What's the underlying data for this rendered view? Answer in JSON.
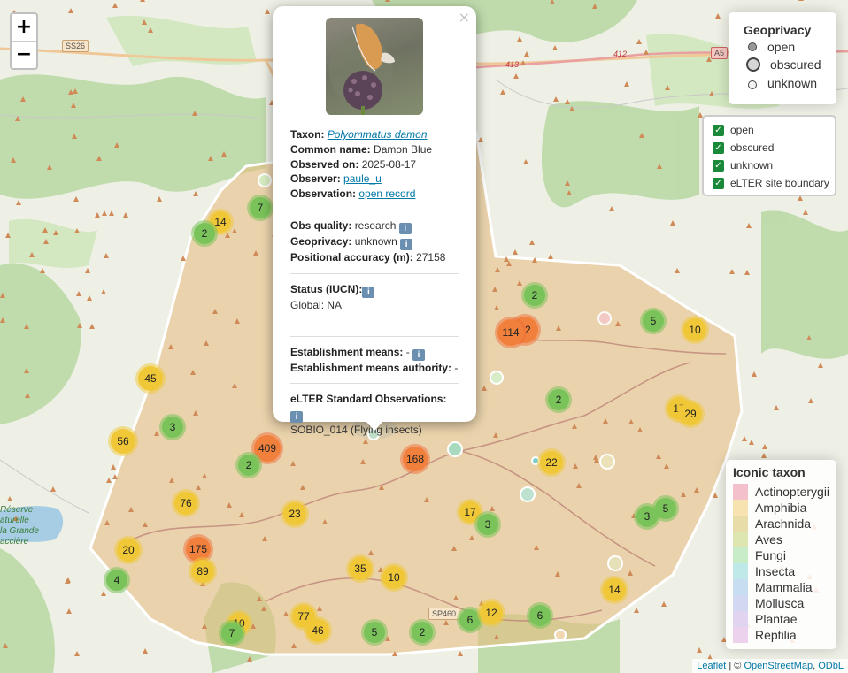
{
  "map": {
    "zoom_in": "+",
    "zoom_out": "−",
    "road_labels": [
      "SS26",
      "413",
      "412",
      "A5",
      "SP460"
    ],
    "place_label": [
      "Réserve",
      "aturelle",
      "la Grande",
      "ассière"
    ],
    "attribution": {
      "leaflet": "Leaflet",
      "sep": " | © ",
      "osm": "OpenStreetMap",
      "comma": ", ",
      "odbl": "ODbL"
    },
    "clusters": [
      {
        "label": "14",
        "color": "yellow"
      },
      {
        "label": "7",
        "color": "green"
      },
      {
        "label": "2",
        "color": "green"
      },
      {
        "label": "45",
        "color": "yellow"
      },
      {
        "label": "3",
        "color": "green"
      },
      {
        "label": "56",
        "color": "yellow"
      },
      {
        "label": "409",
        "color": "orange"
      },
      {
        "label": "2",
        "color": "green"
      },
      {
        "label": "76",
        "color": "yellow"
      },
      {
        "label": "23",
        "color": "yellow"
      },
      {
        "label": "20",
        "color": "yellow"
      },
      {
        "label": "175",
        "color": "orange"
      },
      {
        "label": "89",
        "color": "yellow"
      },
      {
        "label": "4",
        "color": "green"
      },
      {
        "label": "35",
        "color": "yellow"
      },
      {
        "label": "10",
        "color": "yellow"
      },
      {
        "label": "77",
        "color": "yellow"
      },
      {
        "label": "46",
        "color": "yellow"
      },
      {
        "label": "10",
        "color": "yellow"
      },
      {
        "label": "7",
        "color": "green"
      },
      {
        "label": "5",
        "color": "green"
      },
      {
        "label": "2",
        "color": "green"
      },
      {
        "label": "6",
        "color": "green"
      },
      {
        "label": "12",
        "color": "yellow"
      },
      {
        "label": "6",
        "color": "green"
      },
      {
        "label": "168",
        "color": "orange"
      },
      {
        "label": "17",
        "color": "yellow"
      },
      {
        "label": "3",
        "color": "green"
      },
      {
        "label": "22",
        "color": "yellow"
      },
      {
        "label": "2",
        "color": "green"
      },
      {
        "label": "2",
        "color": "green"
      },
      {
        "label": "12",
        "color": "orange"
      },
      {
        "label": "114",
        "color": "orange"
      },
      {
        "label": "5",
        "color": "green"
      },
      {
        "label": "10",
        "color": "yellow"
      },
      {
        "label": "17",
        "color": "yellow"
      },
      {
        "label": "29",
        "color": "yellow"
      },
      {
        "label": "5",
        "color": "green"
      },
      {
        "label": "3",
        "color": "green"
      },
      {
        "label": "14",
        "color": "yellow"
      }
    ]
  },
  "popup": {
    "close": "×",
    "taxon_label": "Taxon:",
    "taxon": "Polyommatus damon",
    "common_label": "Common name:",
    "common": "Damon Blue",
    "observed_label": "Observed on:",
    "observed": "2025-08-17",
    "observer_label": "Observer:",
    "observer": "paule_u",
    "observation_label": "Observation:",
    "observation": "open record",
    "quality_label": "Obs quality:",
    "quality": "research",
    "geoprivacy_label": "Geoprivacy:",
    "geoprivacy": "unknown",
    "accuracy_label": "Positional accuracy (m):",
    "accuracy": "27158",
    "status_label": "Status (IUCN):",
    "status": "Global: NA",
    "establishment_label": "Establishment means:",
    "establishment": "-",
    "establishment_auth_label": "Establishment means authority:",
    "establishment_auth": "-",
    "elter_label": "eLTER Standard Observations:",
    "elter": "SOBIO_014 (Flying insects)",
    "info_glyph": "i"
  },
  "geoprivacy_legend": {
    "title": "Geoprivacy",
    "items": [
      "open",
      "obscured",
      "unknown"
    ]
  },
  "layers": {
    "items": [
      "open",
      "obscured",
      "unknown",
      "eLTER site boundary"
    ],
    "checked": [
      true,
      true,
      true,
      true
    ]
  },
  "taxon_legend": {
    "title": "Iconic taxon",
    "items": [
      {
        "label": "Actinopterygii",
        "color": "#f4c0cc"
      },
      {
        "label": "Amphibia",
        "color": "#f6e3b0"
      },
      {
        "label": "Arachnida",
        "color": "#e8dda8"
      },
      {
        "label": "Aves",
        "color": "#dde6b0"
      },
      {
        "label": "Fungi",
        "color": "#c8ecc8"
      },
      {
        "label": "Insecta",
        "color": "#bfe8e8"
      },
      {
        "label": "Mammalia",
        "color": "#c6def0"
      },
      {
        "label": "Mollusca",
        "color": "#d2d8f2"
      },
      {
        "label": "Plantae",
        "color": "#e0d4f0"
      },
      {
        "label": "Reptilia",
        "color": "#ecd2ec"
      }
    ]
  },
  "colors": {
    "green": "#7ac35a",
    "yellow": "#f0c837",
    "orange": "#f0803c",
    "boundary_fill": "#e8bc7c"
  }
}
